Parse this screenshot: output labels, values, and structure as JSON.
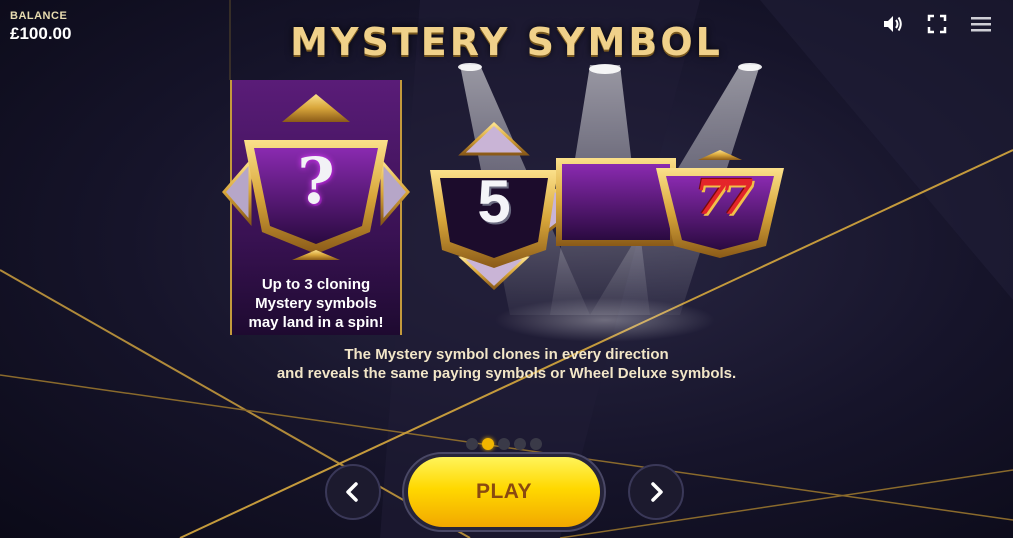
{
  "balance": {
    "label": "BALANCE",
    "value": "£100.00"
  },
  "title": "MYSTERY SYMBOL",
  "symbols": {
    "middle_number": "5",
    "mystery_glyph": "?",
    "sevens_glyph": "77"
  },
  "caption_left": [
    "Up to 3 cloning",
    "Mystery symbols",
    "may land in a spin!"
  ],
  "caption_main": [
    "The Mystery symbol clones in every direction",
    "and reveals the same paying symbols or Wheel Deluxe symbols."
  ],
  "pager": {
    "total": 5,
    "active_index": 1
  },
  "buttons": {
    "play": "PLAY"
  },
  "icons": {
    "sound": "speaker-icon",
    "fullscreen": "fullscreen-icon",
    "menu": "hamburger-menu-icon",
    "prev": "chevron-left-icon",
    "next": "chevron-right-icon"
  },
  "colors": {
    "accent_gold": "#f0d18a",
    "play_yellow": "#ffd800",
    "panel_purple": "#5a1c78",
    "background": "#16142a"
  }
}
